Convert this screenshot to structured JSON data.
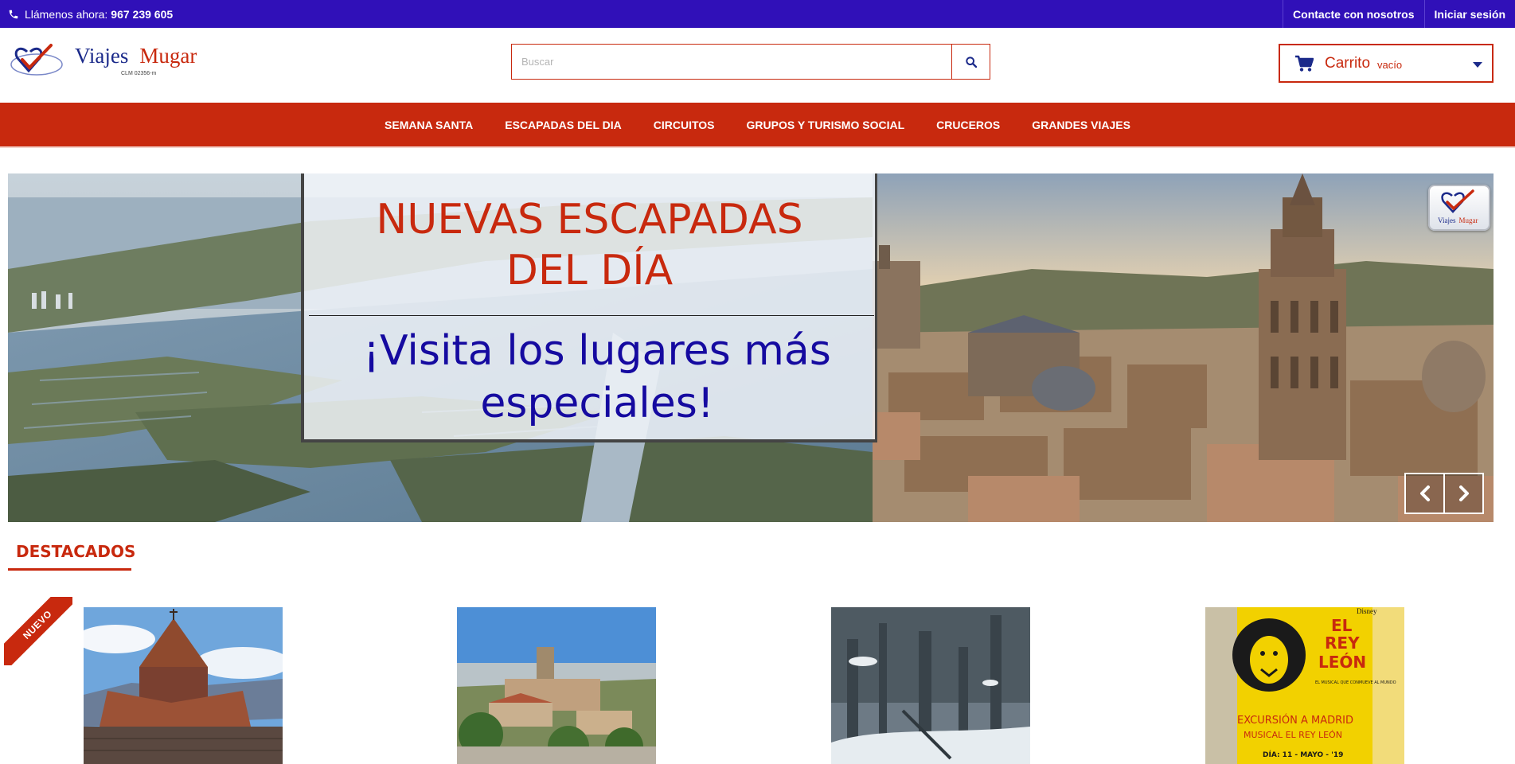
{
  "topbar": {
    "call_label": "Llámenos ahora:",
    "phone": "967 239 605",
    "contact_label": "Contacte con nosotros",
    "login_label": "Iniciar sesión"
  },
  "header": {
    "logo_word1": "Viajes",
    "logo_word2": "Mugar",
    "license": "CLM 02356-m",
    "search_placeholder": "Buscar",
    "cart_label": "Carrito",
    "cart_status": "vacío"
  },
  "nav": {
    "items": [
      {
        "label": "SEMANA SANTA"
      },
      {
        "label": "ESCAPADAS DEL DIA"
      },
      {
        "label": "CIRCUITOS"
      },
      {
        "label": "GRUPOS Y TURISMO SOCIAL"
      },
      {
        "label": "CRUCEROS"
      },
      {
        "label": "GRANDES VIAJES"
      }
    ]
  },
  "slider": {
    "headline_line1": "NUEVAS ESCAPADAS",
    "headline_line2": "DEL DÍA",
    "tagline_line1": "¡Visita los lugares más",
    "tagline_line2": "especiales!",
    "badge_word1": "Viajes",
    "badge_word2": "Mugar"
  },
  "featured": {
    "title": "DESTACADOS",
    "ribbon_label": "NUEVO",
    "poster": {
      "brand": "Disney",
      "title_line1": "EL",
      "title_line2": "REY",
      "title_line3": "LEÓN",
      "subtitle": "EL MUSICAL QUE CONMUEVE AL MUNDO",
      "excursion": "EXCURSIÓN A MADRID",
      "musical": "MUSICAL EL REY LEÓN",
      "date": "DÍA: 11 - MAYO - '19"
    }
  },
  "colors": {
    "topbar": "#3010b8",
    "accent_red": "#c8290e",
    "navy_text": "#150aa0"
  }
}
